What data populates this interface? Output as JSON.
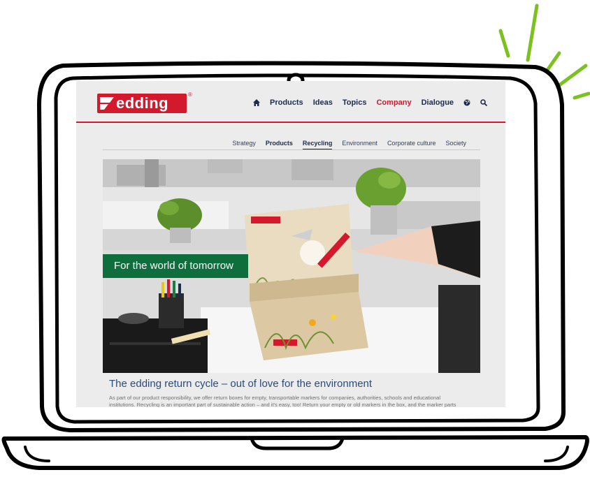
{
  "nav": {
    "items": [
      "Products",
      "Ideas",
      "Topics",
      "Company",
      "Dialogue"
    ],
    "active": "Company"
  },
  "logo": {
    "text": "edding",
    "reg": "®"
  },
  "subnav": {
    "items": [
      "Strategy",
      "Products",
      "Recycling",
      "Environment",
      "Corporate culture",
      "Society"
    ],
    "current": "Recycling"
  },
  "hero": {
    "banner": "For the world of tomorrow",
    "box_label": "edding"
  },
  "article": {
    "headline": "The edding return cycle – out of love for the environment",
    "body_line1": "As part of our product responsibility, we offer return boxes for empty, transportable markers for companies, authorities, schools and educational",
    "body_line2": "institutions. Recycling is an important part of sustainable action – and it's easy, too! Return your empty or old markers in the box, and the marker parts"
  },
  "colors": {
    "brand_red": "#d4192c",
    "navy": "#1a2b4d",
    "banner_green": "#0e6f3c",
    "accent_green": "#7bc11f"
  }
}
